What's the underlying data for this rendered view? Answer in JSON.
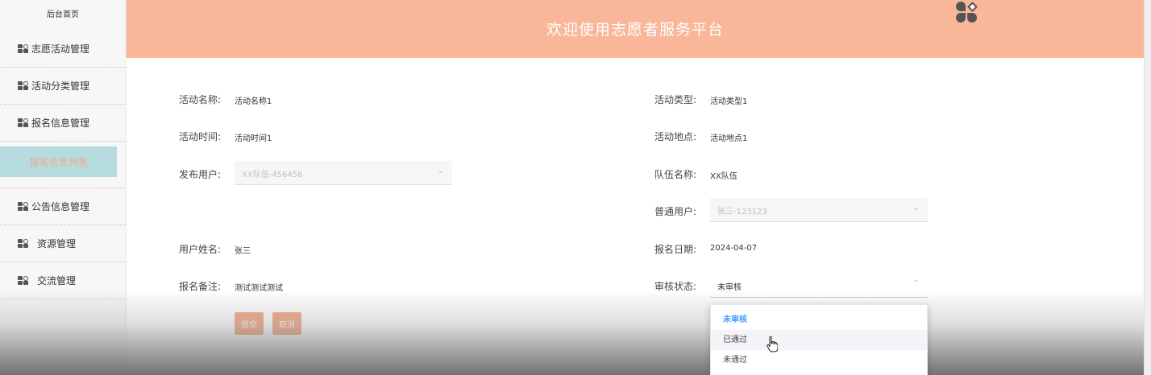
{
  "sidebar": {
    "home": "后台首页",
    "items": [
      {
        "label": "志愿活动管理"
      },
      {
        "label": "活动分类管理"
      },
      {
        "label": "报名信息管理"
      }
    ],
    "sub_item": "报名信息列表",
    "items2": [
      {
        "label": "公告信息管理"
      },
      {
        "label": "资源管理"
      },
      {
        "label": "交流管理"
      }
    ]
  },
  "header": {
    "title": "欢迎使用志愿者服务平台"
  },
  "form": {
    "activity_name_label": "活动名称:",
    "activity_name": "活动名称1",
    "activity_type_label": "活动类型:",
    "activity_type": "活动类型1",
    "activity_time_label": "活动时间:",
    "activity_time": "活动时间1",
    "activity_location_label": "活动地点:",
    "activity_location": "活动地点1",
    "publisher_label": "发布用户:",
    "publisher_value": "XX队伍-456456",
    "team_name_label": "队伍名称:",
    "team_name": "XX队伍",
    "normal_user_label": "普通用户:",
    "normal_user_value": "张三-123123",
    "user_name_label": "用户姓名:",
    "user_name": "张三",
    "signup_date_label": "报名日期:",
    "signup_date": "2024-04-07",
    "remark_label": "报名备注:",
    "remark": "测试测试测试",
    "review_status_label": "审核状态:",
    "review_status_value": "未审核",
    "submit_label": "提交",
    "cancel_label": "取消"
  },
  "dropdown": {
    "options": [
      "未审核",
      "已通过",
      "未通过"
    ]
  },
  "colors": {
    "header": "#f9b699",
    "button": "#f2a784",
    "active_sub": "#b6dcdf",
    "selected_option": "#409eff"
  }
}
